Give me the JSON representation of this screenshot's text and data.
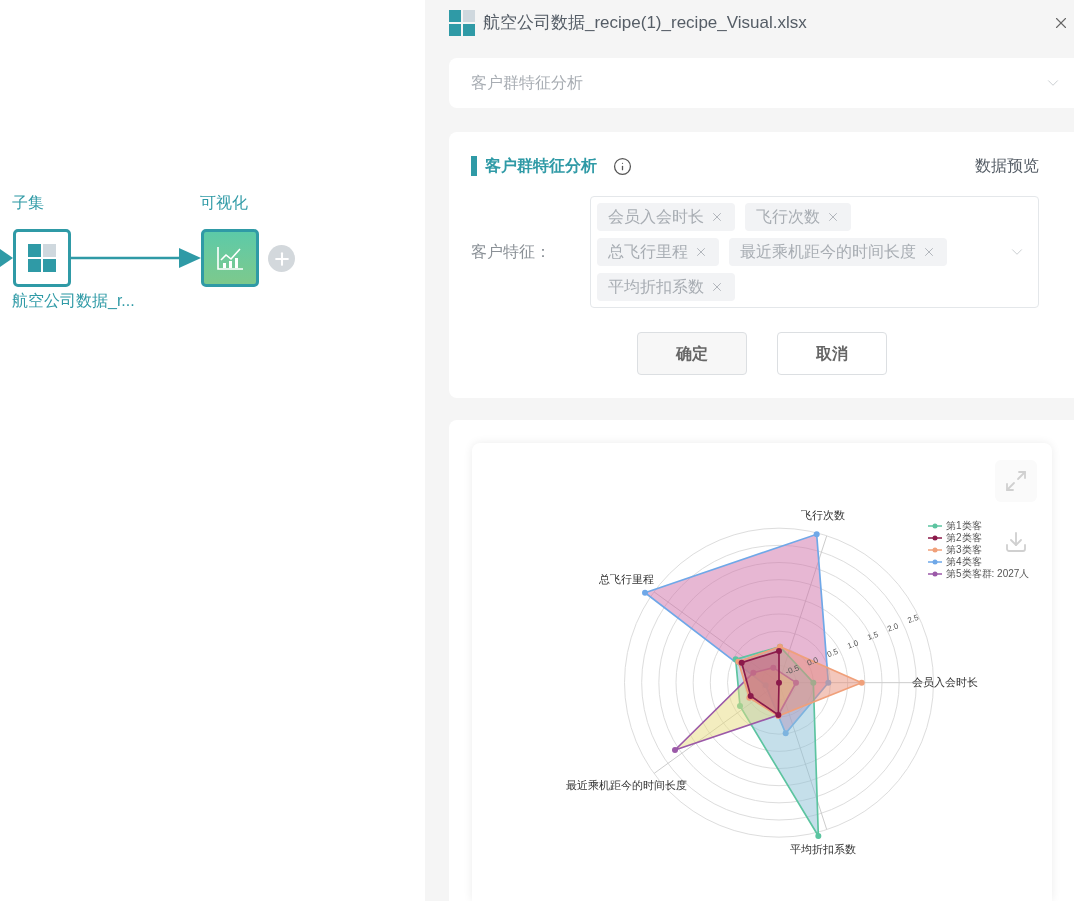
{
  "canvas": {
    "nodes": [
      {
        "kind": "dataset",
        "title": "子集",
        "caption": "航空公司数据_r..."
      },
      {
        "kind": "chart",
        "title": "可视化"
      }
    ]
  },
  "panel": {
    "title": "航空公司数据_recipe(1)_recipe_Visual.xlsx",
    "analysis_select": {
      "value": "客户群特征分析"
    },
    "section": {
      "title": "客户群特征分析",
      "preview_link": "数据预览",
      "field_label": "客户特征：",
      "tags": [
        "会员入会时长",
        "飞行次数",
        "总飞行里程",
        "最近乘机距今的时间长度",
        "平均折扣系数"
      ],
      "buttons": [
        "确定",
        "取消"
      ]
    },
    "chart": {
      "axes": [
        "会员入会时长",
        "飞行次数",
        "总飞行里程",
        "最近乘机距今的时间长度",
        "平均折扣系数"
      ],
      "ticks": [
        "-0.5",
        "0.0",
        "0.5",
        "1.0",
        "1.5",
        "2.0",
        "2.5"
      ],
      "legend": [
        {
          "label": "第1类客",
          "color": "#5cc4a0"
        },
        {
          "label": "第2类客",
          "color": "#8b1a4a"
        },
        {
          "label": "第3类客",
          "color": "#f0a07a"
        },
        {
          "label": "第4类客",
          "color": "#6fa8e8"
        },
        {
          "label": "第5类客群: 2027人",
          "color": "#9b59a8"
        }
      ]
    }
  }
}
